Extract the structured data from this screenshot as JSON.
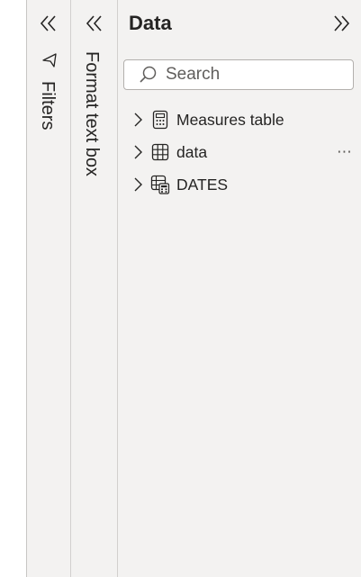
{
  "filters": {
    "title": "Filters",
    "collapse_icon": "double-chevron-left-icon",
    "filter_icon": "funnel-icon"
  },
  "format": {
    "title": "Format text box",
    "collapse_icon": "double-chevron-left-icon"
  },
  "data_pane": {
    "title": "Data",
    "expand_icon": "double-chevron-right-icon",
    "search": {
      "placeholder": "Search",
      "value": ""
    },
    "items": [
      {
        "label": "Measures table",
        "icon": "calculator-table-icon"
      },
      {
        "label": "data",
        "icon": "table-icon",
        "more": "⋯"
      },
      {
        "label": "DATES",
        "icon": "calculated-table-icon"
      }
    ]
  }
}
